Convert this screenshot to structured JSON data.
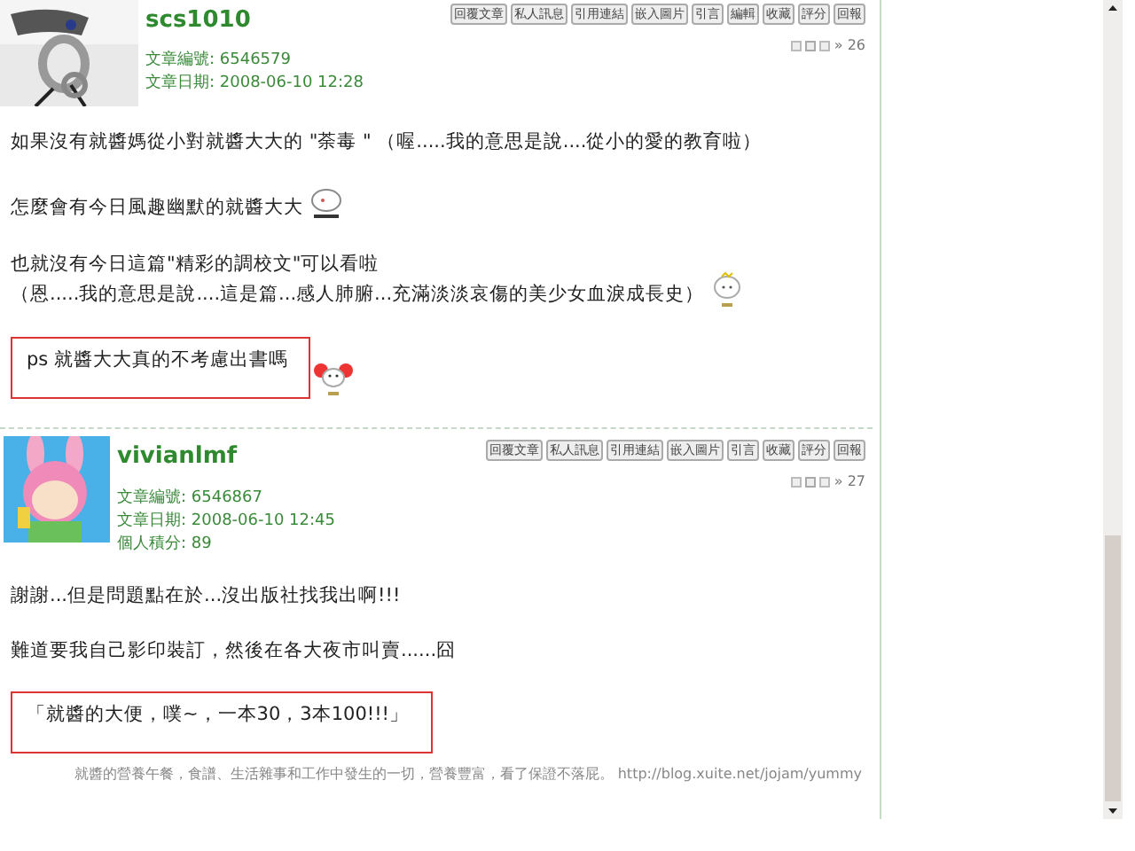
{
  "posts": [
    {
      "author": "scs1010",
      "avatar": {
        "kind": "picture"
      },
      "meta": [
        {
          "label": "文章編號:",
          "value": "6546579"
        },
        {
          "label": "文章日期:",
          "value": "2008-06-10 12:28"
        }
      ],
      "actions": [
        "回覆文章",
        "私人訊息",
        "引用連結",
        "嵌入圖片",
        "引言",
        "編輯",
        "收藏",
        "評分",
        "回報"
      ],
      "floor": "» 26",
      "body": [
        {
          "kind": "plain",
          "lines": [
            "如果沒有就醬媽從小對就醬大大的 \"荼毒 \" （喔.....我的意思是說....從小的愛的教育啦）"
          ],
          "emoticon": false
        },
        {
          "kind": "plain",
          "lines": [
            "怎麼會有今日風趣幽默的就醬大大"
          ],
          "emoticon": true
        },
        {
          "kind": "plain",
          "lines": [
            "也就沒有今日這篇\"精彩的調校文\"可以看啦",
            "（恩.....我的意思是說....這是篇...感人肺腑...充滿淡淡哀傷的美少女血淚成長史）"
          ],
          "emoticon": true
        },
        {
          "kind": "boxed",
          "lines": [
            "ps 就醬大大真的不考慮出書嗎"
          ],
          "emoticon": true
        }
      ]
    },
    {
      "author": "vivianlmf",
      "avatar": {
        "kind": "picture"
      },
      "meta": [
        {
          "label": "文章編號:",
          "value": "6546867"
        },
        {
          "label": "文章日期:",
          "value": "2008-06-10 12:45"
        },
        {
          "label": "個人積分:",
          "value": "89"
        }
      ],
      "actions": [
        "回覆文章",
        "私人訊息",
        "引用連結",
        "嵌入圖片",
        "引言",
        "收藏",
        "評分",
        "回報"
      ],
      "floor": "» 27",
      "body": [
        {
          "kind": "plain",
          "lines": [
            "謝謝...但是問題點在於...沒出版社找我出啊!!!"
          ],
          "emoticon": false
        },
        {
          "kind": "plain",
          "lines": [
            "難道要我自己影印裝訂，然後在各大夜市叫賣......囧"
          ],
          "emoticon": false
        },
        {
          "kind": "boxed",
          "lines": [
            "「就醬的大便，噗~，一本30，3本100!!!」"
          ],
          "emoticon": false
        }
      ]
    }
  ],
  "signature": {
    "text": "就醬的營養午餐，食譜、生活雜事和工作中發生的一切，營養豐富，看了保證不落屁。",
    "url": "http://blog.xuite.net/jojam/yummy"
  }
}
